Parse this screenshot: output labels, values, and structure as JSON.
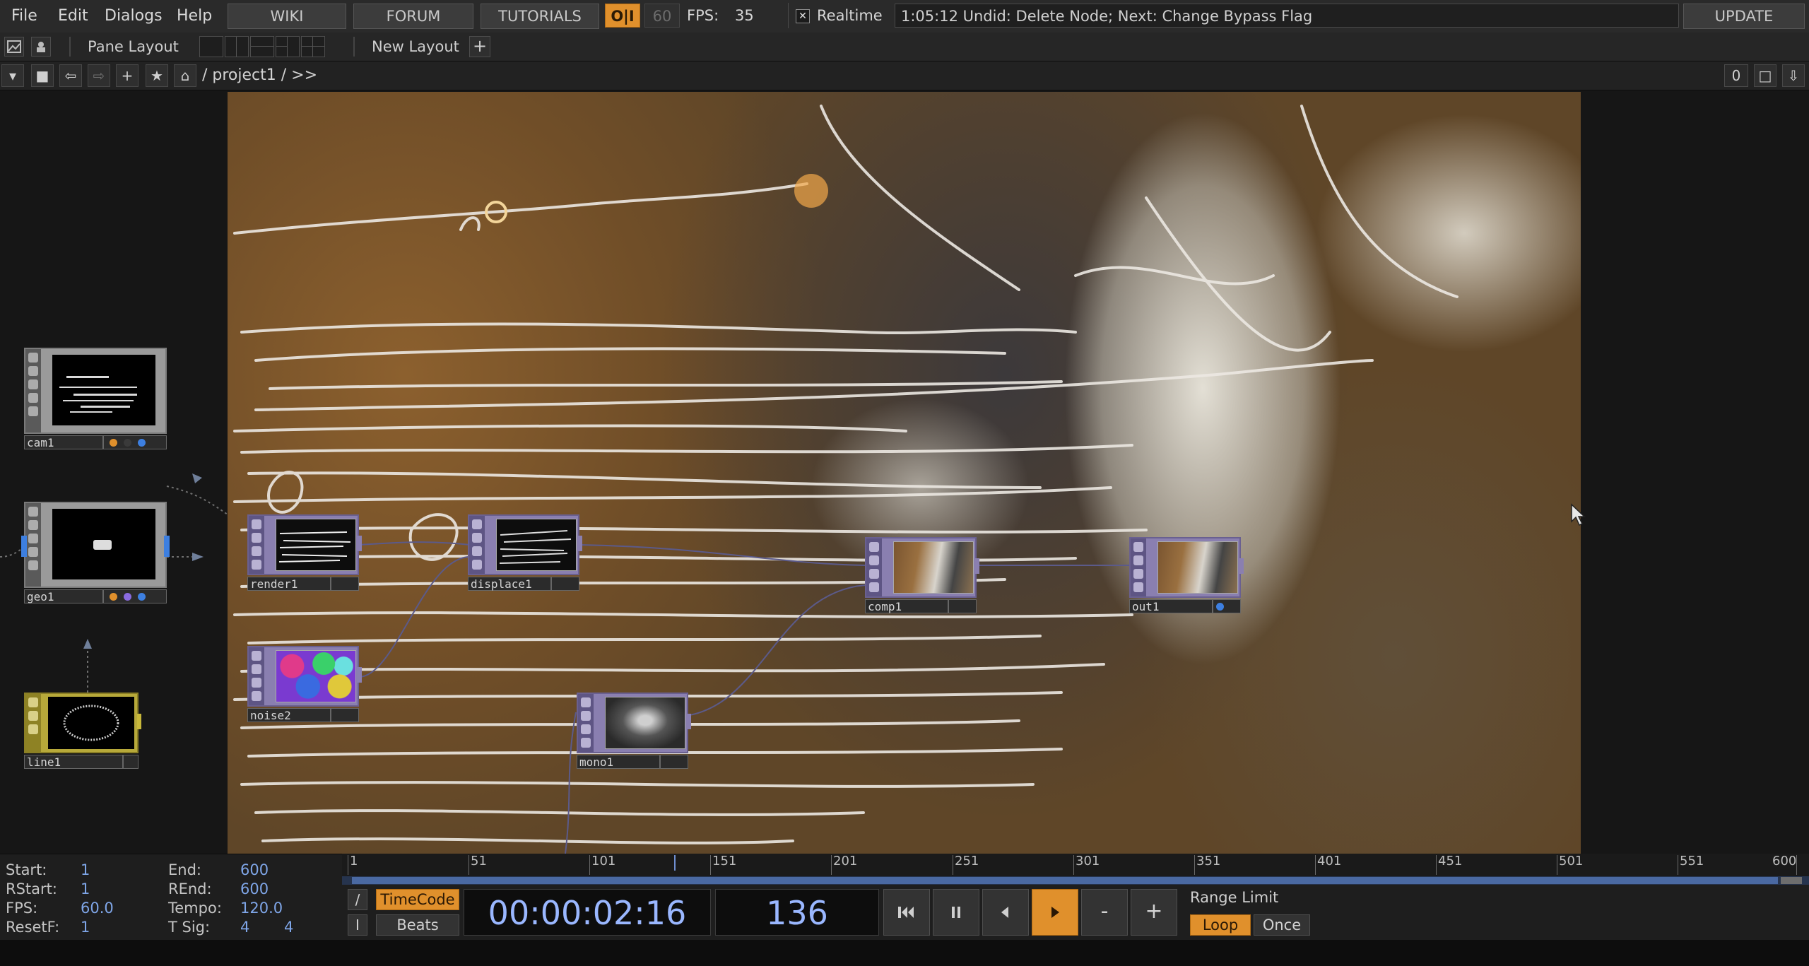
{
  "menu": {
    "file": "File",
    "edit": "Edit",
    "dialogs": "Dialogs",
    "help": "Help",
    "wiki": "WIKI",
    "forum": "FORUM",
    "tutorials": "TUTORIALS",
    "oi": "O|I",
    "fps_target": "60",
    "fps_label": "FPS:",
    "fps_value": "35",
    "realtime_check": "✕",
    "realtime_label": "Realtime",
    "command_status": "1:05:12 Undid: Delete Node; Next: Change Bypass Flag",
    "update": "UPDATE"
  },
  "pane_bar": {
    "pane_layout": "Pane Layout",
    "new_layout": "New Layout",
    "add": "+"
  },
  "path_bar": {
    "path": "/ project1 / >>",
    "counter": "0"
  },
  "nodes": [
    {
      "id": "cam1",
      "label": "cam1",
      "color": "gray"
    },
    {
      "id": "geo1",
      "label": "geo1",
      "color": "gray"
    },
    {
      "id": "line1",
      "label": "line1",
      "color": "yellow"
    },
    {
      "id": "render1",
      "label": "render1",
      "color": "purple"
    },
    {
      "id": "displace1",
      "label": "displace1",
      "color": "purple"
    },
    {
      "id": "noise2",
      "label": "noise2",
      "color": "purple"
    },
    {
      "id": "mono1",
      "label": "mono1",
      "color": "purple"
    },
    {
      "id": "comp1",
      "label": "comp1",
      "color": "purple"
    },
    {
      "id": "out1",
      "label": "out1",
      "color": "purple"
    }
  ],
  "timeline": {
    "start_label": "Start:",
    "start": "1",
    "rstart_label": "RStart:",
    "rstart": "1",
    "fps_label": "FPS:",
    "fps": "60.0",
    "resetf_label": "ResetF:",
    "resetf": "1",
    "end_label": "End:",
    "end": "600",
    "rend_label": "REnd:",
    "rend": "600",
    "tempo_label": "Tempo:",
    "tempo": "120.0",
    "tsig_label": "T Sig:",
    "tsig_num": "4",
    "tsig_den": "4",
    "ticks": [
      "1",
      "51",
      "101",
      "151",
      "201",
      "251",
      "301",
      "351",
      "401",
      "451",
      "501",
      "551",
      "600"
    ],
    "current_frame_marker": 136,
    "range": [
      1,
      600
    ],
    "timecode_btn": "TimeCode",
    "beats_btn": "Beats",
    "slash": "/",
    "bar": "I",
    "timecode": "00:00:02:16",
    "frame": "136",
    "range_limit": "Range Limit",
    "loop": "Loop",
    "once": "Once",
    "minus": "-",
    "plus": "+"
  },
  "colors": {
    "accent_orange": "#e0902c",
    "timecode_blue": "#9ab7ff",
    "op_purple": "#8a7fb0",
    "op_yellow": "#b7a93a"
  }
}
